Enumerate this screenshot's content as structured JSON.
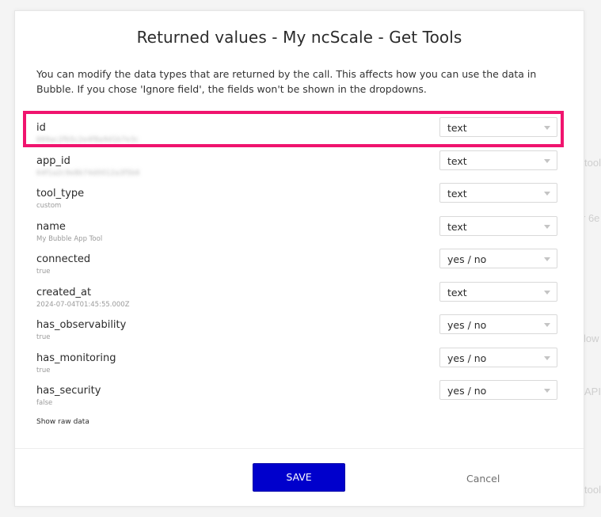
{
  "background": {
    "hints": [
      {
        "text": "tool",
        "row": 1
      },
      {
        "text": "r 6e",
        "row": 2
      },
      {
        "text": "low",
        "row": 3
      },
      {
        "text": "API",
        "row": 4
      },
      {
        "text": "tool",
        "row": 5
      }
    ]
  },
  "modal": {
    "title": "Returned values - My ncScale - Get Tools",
    "description": "You can modify the data types that are returned by the call. This affects how you can use the data in Bubble. If you chose 'Ignore field', the fields won't be shown in the dropdowns.",
    "fields": [
      {
        "name": "id",
        "sample": "669ac2fb5c2e4f8a9d1b7e3c",
        "sample_blurred": true,
        "type": "text",
        "highlighted": true
      },
      {
        "name": "app_id",
        "sample": "64f1a2c9e8b74d0012a3f5b6",
        "sample_blurred": true,
        "type": "text",
        "highlighted": false
      },
      {
        "name": "tool_type",
        "sample": "custom",
        "sample_blurred": false,
        "type": "text",
        "highlighted": false
      },
      {
        "name": "name",
        "sample": "My Bubble App Tool",
        "sample_blurred": false,
        "type": "text",
        "highlighted": false
      },
      {
        "name": "connected",
        "sample": "true",
        "sample_blurred": false,
        "type": "yes / no",
        "highlighted": false
      },
      {
        "name": "created_at",
        "sample": "2024-07-04T01:45:55.000Z",
        "sample_blurred": false,
        "type": "text",
        "highlighted": false
      },
      {
        "name": "has_observability",
        "sample": "true",
        "sample_blurred": false,
        "type": "yes / no",
        "highlighted": false
      },
      {
        "name": "has_monitoring",
        "sample": "true",
        "sample_blurred": false,
        "type": "yes / no",
        "highlighted": false
      },
      {
        "name": "has_security",
        "sample": "false",
        "sample_blurred": false,
        "type": "yes / no",
        "highlighted": false
      }
    ],
    "raw_data_link": "Show raw data",
    "save_label": "SAVE",
    "cancel_label": "Cancel"
  },
  "colors": {
    "highlight": "#f0146e",
    "primary_button": "#0000cc"
  }
}
